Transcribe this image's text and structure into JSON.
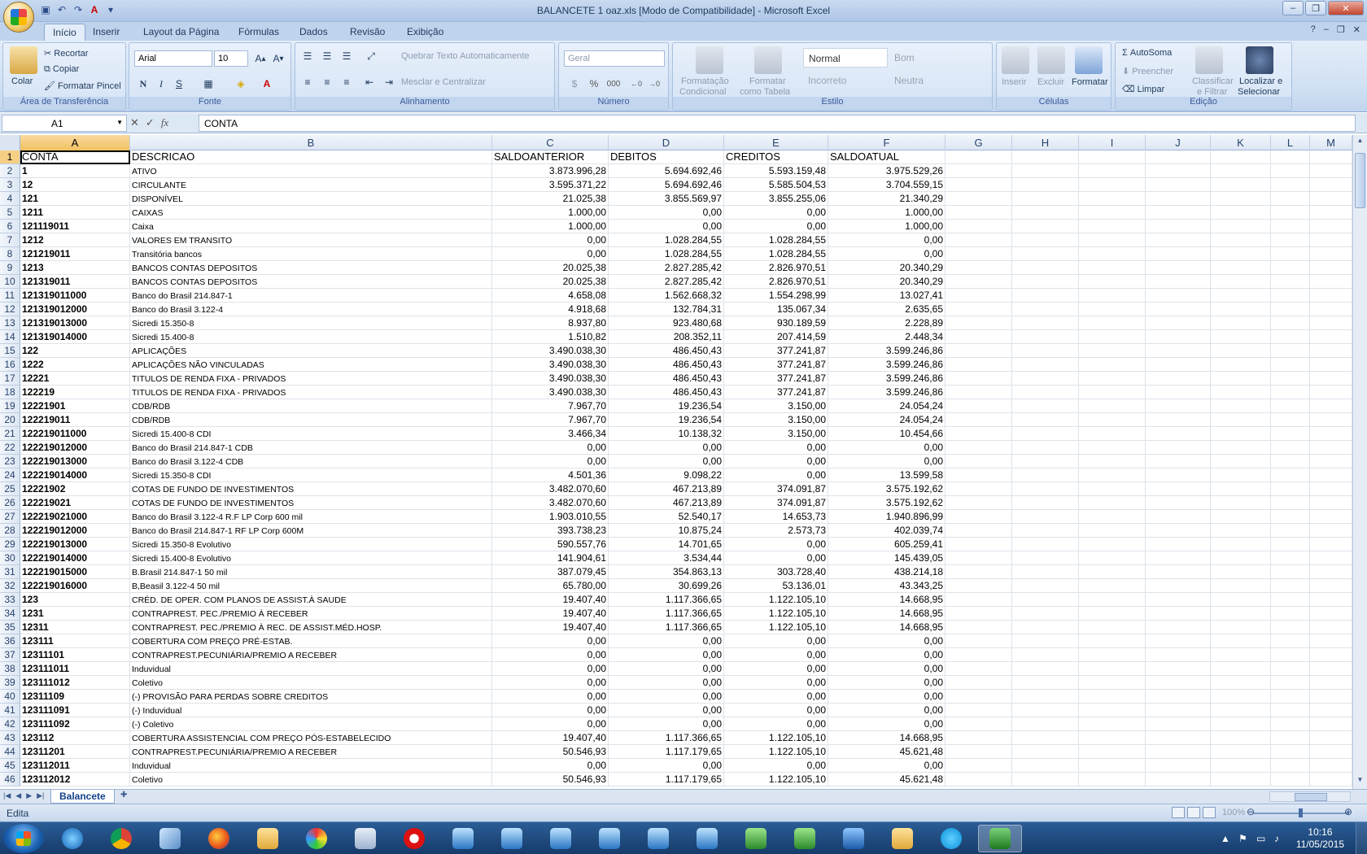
{
  "window": {
    "title": "BALANCETE 1 oaz.xls  [Modo de Compatibilidade] - Microsoft Excel"
  },
  "tabs": [
    "Início",
    "Inserir",
    "Layout da Página",
    "Fórmulas",
    "Dados",
    "Revisão",
    "Exibição"
  ],
  "ribbon": {
    "clipboard": {
      "paste": "Colar",
      "cut": "Recortar",
      "copy": "Copiar",
      "format_painter": "Formatar Pincel",
      "label": "Área de Transferência"
    },
    "font": {
      "name": "Arial",
      "size": "10",
      "label": "Fonte",
      "bold": "N",
      "italic": "I",
      "underline": "S"
    },
    "alignment": {
      "wrap": "Quebrar Texto Automaticamente",
      "merge": "Mesclar e Centralizar",
      "label": "Alinhamento"
    },
    "number": {
      "format": "Geral",
      "percent": "%",
      "thousands": "000",
      "label": "Número"
    },
    "styles": {
      "cond1": "Formatação",
      "cond2": "Condicional",
      "table1": "Formatar",
      "table2": "como Tabela",
      "normal": "Normal",
      "bom": "Bom",
      "incorreto": "Incorreto",
      "neutra": "Neutra",
      "label": "Estilo"
    },
    "cells": {
      "insert": "Inserir",
      "delete": "Excluir",
      "format": "Formatar",
      "label": "Células"
    },
    "editing": {
      "autosum": "AutoSoma",
      "fill": "Preencher",
      "clear": "Limpar",
      "sort1": "Classificar",
      "sort2": "e Filtrar",
      "find1": "Localizar e",
      "find2": "Selecionar",
      "label": "Edição"
    }
  },
  "formula_bar": {
    "name_box": "A1",
    "content": "CONTA"
  },
  "columns": [
    "A",
    "B",
    "C",
    "D",
    "E",
    "F",
    "G",
    "H",
    "I",
    "J",
    "K",
    "L",
    "M"
  ],
  "rows": [
    [
      "CONTA",
      "DESCRICAO",
      "SALDOANTERIOR",
      "DEBITOS",
      "CREDITOS",
      "SALDOATUAL"
    ],
    [
      "1",
      "ATIVO",
      "3.873.996,28",
      "5.694.692,46",
      "5.593.159,48",
      "3.975.529,26"
    ],
    [
      "12",
      "CIRCULANTE",
      "3.595.371,22",
      "5.694.692,46",
      "5.585.504,53",
      "3.704.559,15"
    ],
    [
      "121",
      "DISPONÍVEL",
      "21.025,38",
      "3.855.569,97",
      "3.855.255,06",
      "21.340,29"
    ],
    [
      "1211",
      "CAIXAS",
      "1.000,00",
      "0,00",
      "0,00",
      "1.000,00"
    ],
    [
      "121119011",
      "Caixa",
      "1.000,00",
      "0,00",
      "0,00",
      "1.000,00"
    ],
    [
      "1212",
      "VALORES EM TRANSITO",
      "0,00",
      "1.028.284,55",
      "1.028.284,55",
      "0,00"
    ],
    [
      "121219011",
      "Transitória bancos",
      "0,00",
      "1.028.284,55",
      "1.028.284,55",
      "0,00"
    ],
    [
      "1213",
      "BANCOS CONTAS DEPOSITOS",
      "20.025,38",
      "2.827.285,42",
      "2.826.970,51",
      "20.340,29"
    ],
    [
      "121319011",
      "BANCOS CONTAS DEPOSITOS",
      "20.025,38",
      "2.827.285,42",
      "2.826.970,51",
      "20.340,29"
    ],
    [
      "121319011000",
      "Banco do Brasil 214.847-1",
      "4.658,08",
      "1.562.668,32",
      "1.554.298,99",
      "13.027,41"
    ],
    [
      "121319012000",
      "Banco do Brasil 3.122-4",
      "4.918,68",
      "132.784,31",
      "135.067,34",
      "2.635,65"
    ],
    [
      "121319013000",
      "Sicredi 15.350-8",
      "8.937,80",
      "923.480,68",
      "930.189,59",
      "2.228,89"
    ],
    [
      "121319014000",
      "Sicredi 15.400-8",
      "1.510,82",
      "208.352,11",
      "207.414,59",
      "2.448,34"
    ],
    [
      "122",
      "APLICAÇÕES",
      "3.490.038,30",
      "486.450,43",
      "377.241,87",
      "3.599.246,86"
    ],
    [
      "1222",
      "APLICAÇÕES NÃO VINCULADAS",
      "3.490.038,30",
      "486.450,43",
      "377.241,87",
      "3.599.246,86"
    ],
    [
      "12221",
      "TITULOS DE RENDA FIXA - PRIVADOS",
      "3.490.038,30",
      "486.450,43",
      "377.241,87",
      "3.599.246,86"
    ],
    [
      "122219",
      "TITULOS DE RENDA FIXA - PRIVADOS",
      "3.490.038,30",
      "486.450,43",
      "377.241,87",
      "3.599.246,86"
    ],
    [
      "12221901",
      "CDB/RDB",
      "7.967,70",
      "19.236,54",
      "3.150,00",
      "24.054,24"
    ],
    [
      "122219011",
      "CDB/RDB",
      "7.967,70",
      "19.236,54",
      "3.150,00",
      "24.054,24"
    ],
    [
      "122219011000",
      "Sicredi 15.400-8 CDI",
      "3.466,34",
      "10.138,32",
      "3.150,00",
      "10.454,66"
    ],
    [
      "122219012000",
      "Banco do Brasil 214.847-1 CDB",
      "0,00",
      "0,00",
      "0,00",
      "0,00"
    ],
    [
      "122219013000",
      "Banco do Brasil 3.122-4 CDB",
      "0,00",
      "0,00",
      "0,00",
      "0,00"
    ],
    [
      "122219014000",
      "Sicredi 15.350-8 CDI",
      "4.501,36",
      "9.098,22",
      "0,00",
      "13.599,58"
    ],
    [
      "12221902",
      "COTAS DE FUNDO DE INVESTIMENTOS",
      "3.482.070,60",
      "467.213,89",
      "374.091,87",
      "3.575.192,62"
    ],
    [
      "122219021",
      "COTAS DE FUNDO DE INVESTIMENTOS",
      "3.482.070,60",
      "467.213,89",
      "374.091,87",
      "3.575.192,62"
    ],
    [
      "122219021000",
      "Banco do Brasil 3.122-4 R.F LP  Corp 600 mil",
      "1.903.010,55",
      "52.540,17",
      "14.653,73",
      "1.940.896,99"
    ],
    [
      "122219012000",
      "Banco do Brasil 214.847-1 RF LP Corp 600M",
      "393.738,23",
      "10.875,24",
      "2.573,73",
      "402.039,74"
    ],
    [
      "122219013000",
      "Sicredi 15.350-8 Evolutivo",
      "590.557,76",
      "14.701,65",
      "0,00",
      "605.259,41"
    ],
    [
      "122219014000",
      "Sicredi 15.400-8 Evolutivo",
      "141.904,61",
      "3.534,44",
      "0,00",
      "145.439,05"
    ],
    [
      "122219015000",
      "B.Brasil 214.847-1 50 mil",
      "387.079,45",
      "354.863,13",
      "303.728,40",
      "438.214,18"
    ],
    [
      "122219016000",
      "B,Beasil 3.122-4 50 mil",
      "65.780,00",
      "30.699,26",
      "53.136,01",
      "43.343,25"
    ],
    [
      "123",
      "CRÉD. DE OPER. COM PLANOS DE ASSIST.À SAUDE",
      "19.407,40",
      "1.117.366,65",
      "1.122.105,10",
      "14.668,95"
    ],
    [
      "1231",
      "CONTRAPREST. PEC./PREMIO À RECEBER",
      "19.407,40",
      "1.117.366,65",
      "1.122.105,10",
      "14.668,95"
    ],
    [
      "12311",
      "CONTRAPREST. PEC./PREMIO À REC. DE ASSIST.MÉD.HOSP.",
      "19.407,40",
      "1.117.366,65",
      "1.122.105,10",
      "14.668,95"
    ],
    [
      "123111",
      "COBERTURA COM PREÇO PRÉ-ESTAB.",
      "0,00",
      "0,00",
      "0,00",
      "0,00"
    ],
    [
      "12311101",
      "CONTRAPREST.PECUNIÁRIA/PREMIO A RECEBER",
      "0,00",
      "0,00",
      "0,00",
      "0,00"
    ],
    [
      "123111011",
      "Induvidual",
      "0,00",
      "0,00",
      "0,00",
      "0,00"
    ],
    [
      "123111012",
      "Coletivo",
      "0,00",
      "0,00",
      "0,00",
      "0,00"
    ],
    [
      "12311109",
      "(-) PROVISÃO PARA PERDAS SOBRE CREDITOS",
      "0,00",
      "0,00",
      "0,00",
      "0,00"
    ],
    [
      "123111091",
      "(-) Induvidual",
      "0,00",
      "0,00",
      "0,00",
      "0,00"
    ],
    [
      "123111092",
      "(-) Coletivo",
      "0,00",
      "0,00",
      "0,00",
      "0,00"
    ],
    [
      "123112",
      "COBERTURA ASSISTENCIAL COM PREÇO PÓS-ESTABELECIDO",
      "19.407,40",
      "1.117.366,65",
      "1.122.105,10",
      "14.668,95"
    ],
    [
      "12311201",
      "CONTRAPREST.PECUNIÁRIA/PREMIO A RECEBER",
      "50.546,93",
      "1.117.179,65",
      "1.122.105,10",
      "45.621,48"
    ],
    [
      "123112011",
      "Induvidual",
      "0,00",
      "0,00",
      "0,00",
      "0,00"
    ],
    [
      "123112012",
      "Coletivo",
      "50.546,93",
      "1.117.179,65",
      "1.122.105,10",
      "45.621,48"
    ]
  ],
  "sheet_tab": "Balancete",
  "status": {
    "mode": "Edita",
    "zoom": "100%"
  },
  "clock": {
    "time": "10:16",
    "date": "11/05/2015"
  }
}
